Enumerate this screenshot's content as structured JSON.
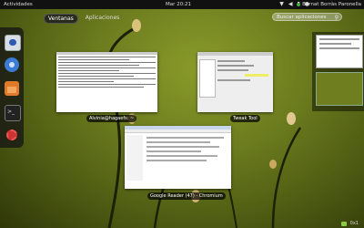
{
  "top_panel": {
    "activities_label": "Actividades",
    "clock": "Mar 20:21",
    "user_name": "Bernat Borràs Paronella"
  },
  "overview": {
    "tabs": [
      {
        "label": "Ventanas",
        "active": true
      },
      {
        "label": "Aplicaciones",
        "active": false
      }
    ],
    "search_placeholder": "Buscar aplicaciones"
  },
  "dash": {
    "items": [
      {
        "name": "mail-icon"
      },
      {
        "name": "chromium-icon"
      },
      {
        "name": "files-icon"
      },
      {
        "name": "terminal-icon"
      },
      {
        "name": "settings-icon"
      }
    ]
  },
  "windows": [
    {
      "title": "Alvinia@hagaefs: ~"
    },
    {
      "title": "Tweak Tool"
    },
    {
      "title": "Google Reader (47) - Chromium"
    }
  ],
  "bottom_tray": {
    "count": "0x1"
  },
  "colors": {
    "panel": "#111111",
    "wallpaper": "#6e7e1f"
  }
}
